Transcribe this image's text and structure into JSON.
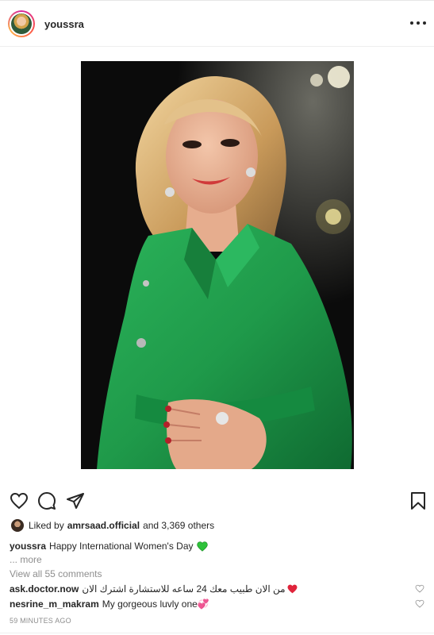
{
  "header": {
    "username": "youssra",
    "more_icon": "ellipsis-icon"
  },
  "actions": {
    "like_icon": "heart-outline-icon",
    "comment_icon": "comment-icon",
    "share_icon": "paper-plane-icon",
    "save_icon": "bookmark-icon"
  },
  "likes": {
    "prefix": "Liked by",
    "user": "amrsaad.official",
    "suffix": "and 3,369 others"
  },
  "caption": {
    "username": "youssra",
    "text": "Happy International Women's Day",
    "emoji_icon": "green-heart-icon",
    "emoji_color": "#2ec23a",
    "more": "... more"
  },
  "comments": {
    "view_all": "View all 55 comments",
    "items": [
      {
        "username": "ask.doctor.now",
        "text": "من الان طبيب معك 24 ساعه للاستشارة اشترك الان",
        "emoji_icon": "red-heart-icon",
        "emoji_color": "#e0243b"
      },
      {
        "username": "nesrine_m_makram",
        "text": "My gorgeous luvly one💞"
      }
    ]
  },
  "timestamp": "59 MINUTES AGO",
  "colors": {
    "muted": "#8e8e8e",
    "text": "#262626",
    "dress_green": "#1f9a4a"
  }
}
